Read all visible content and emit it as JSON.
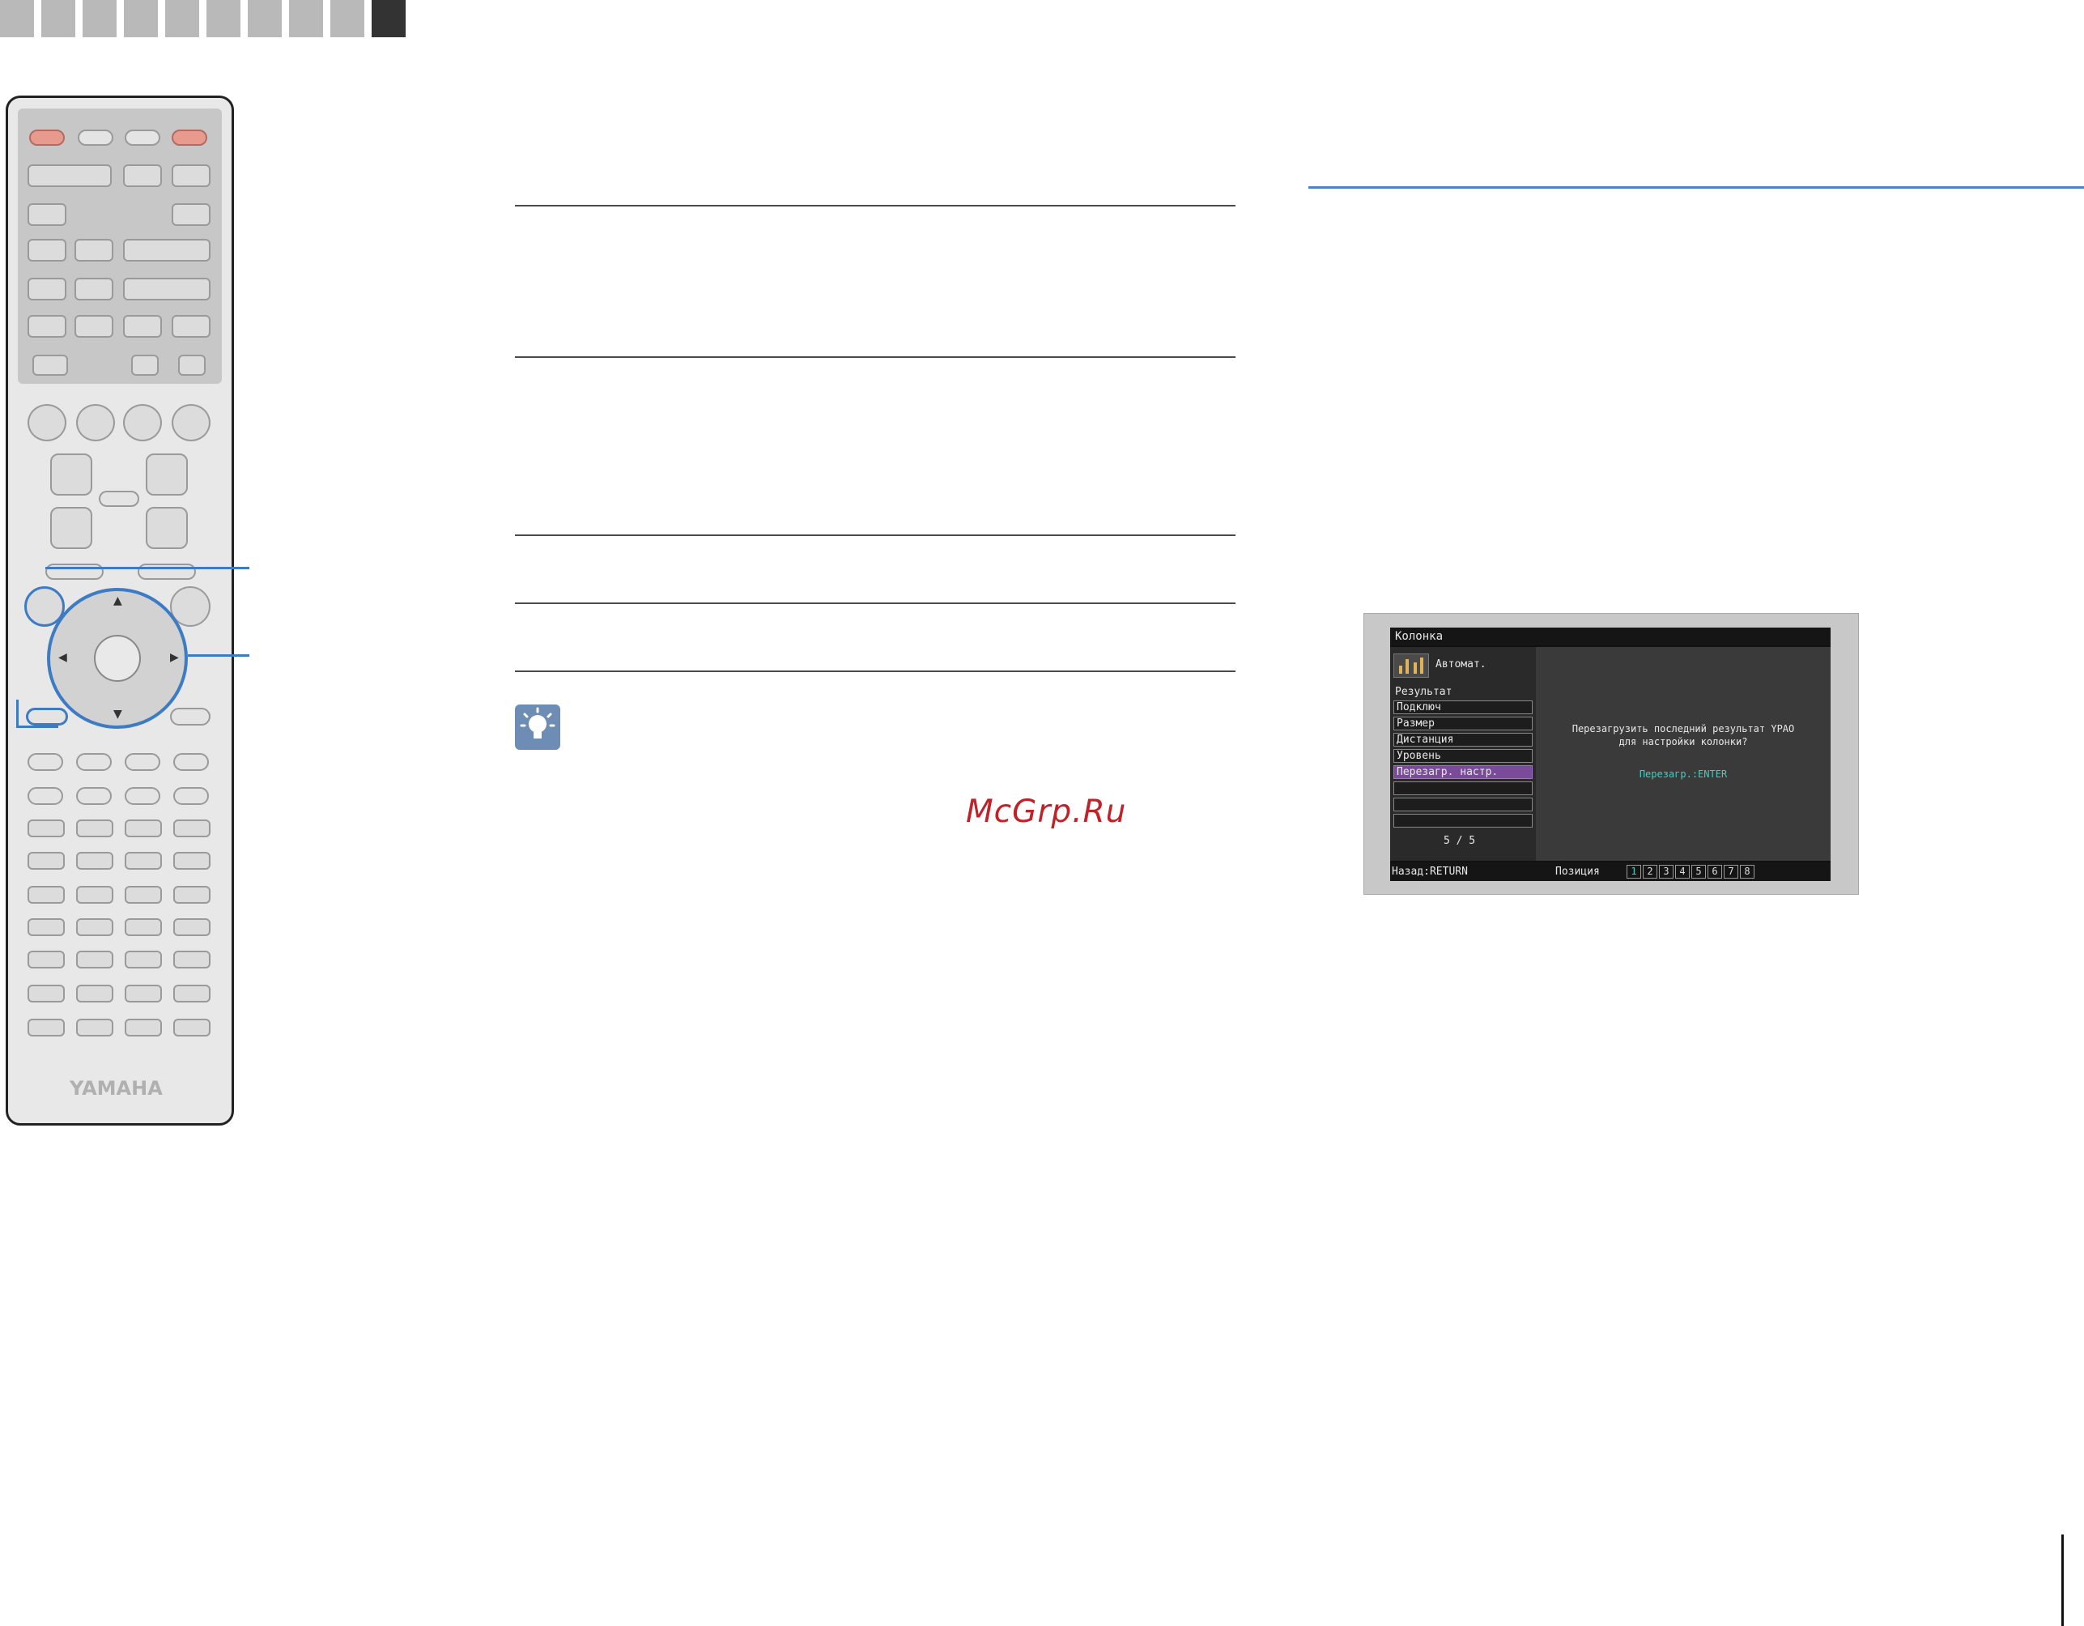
{
  "brand": "YAMAHA",
  "watermark": "McGrp.Ru",
  "osd": {
    "title": "Колонка",
    "mode_label": "Автомат.",
    "section": "Результат",
    "menu_items": [
      "Подключ",
      "Размер",
      "Дистанция",
      "Уровень",
      "Перезагр. настр.",
      "",
      "",
      ""
    ],
    "selected_index": 4,
    "page_indicator": "5 / 5",
    "message_line1": "Перезагрузить последний результат YPAO",
    "message_line2": "для настройки колонки?",
    "action": "Перезагр.:ENTER",
    "back_label": "Назад:RETURN",
    "position_label": "Позиция",
    "positions": [
      "1",
      "2",
      "3",
      "4",
      "5",
      "6",
      "7",
      "8"
    ],
    "current_position": 1
  },
  "colors": {
    "accent_rule": "#4d83c8",
    "selection": "#7a4b9b",
    "action_text": "#3fd0c0",
    "watermark": "#c0222a",
    "power_button": "#e89a8e"
  }
}
